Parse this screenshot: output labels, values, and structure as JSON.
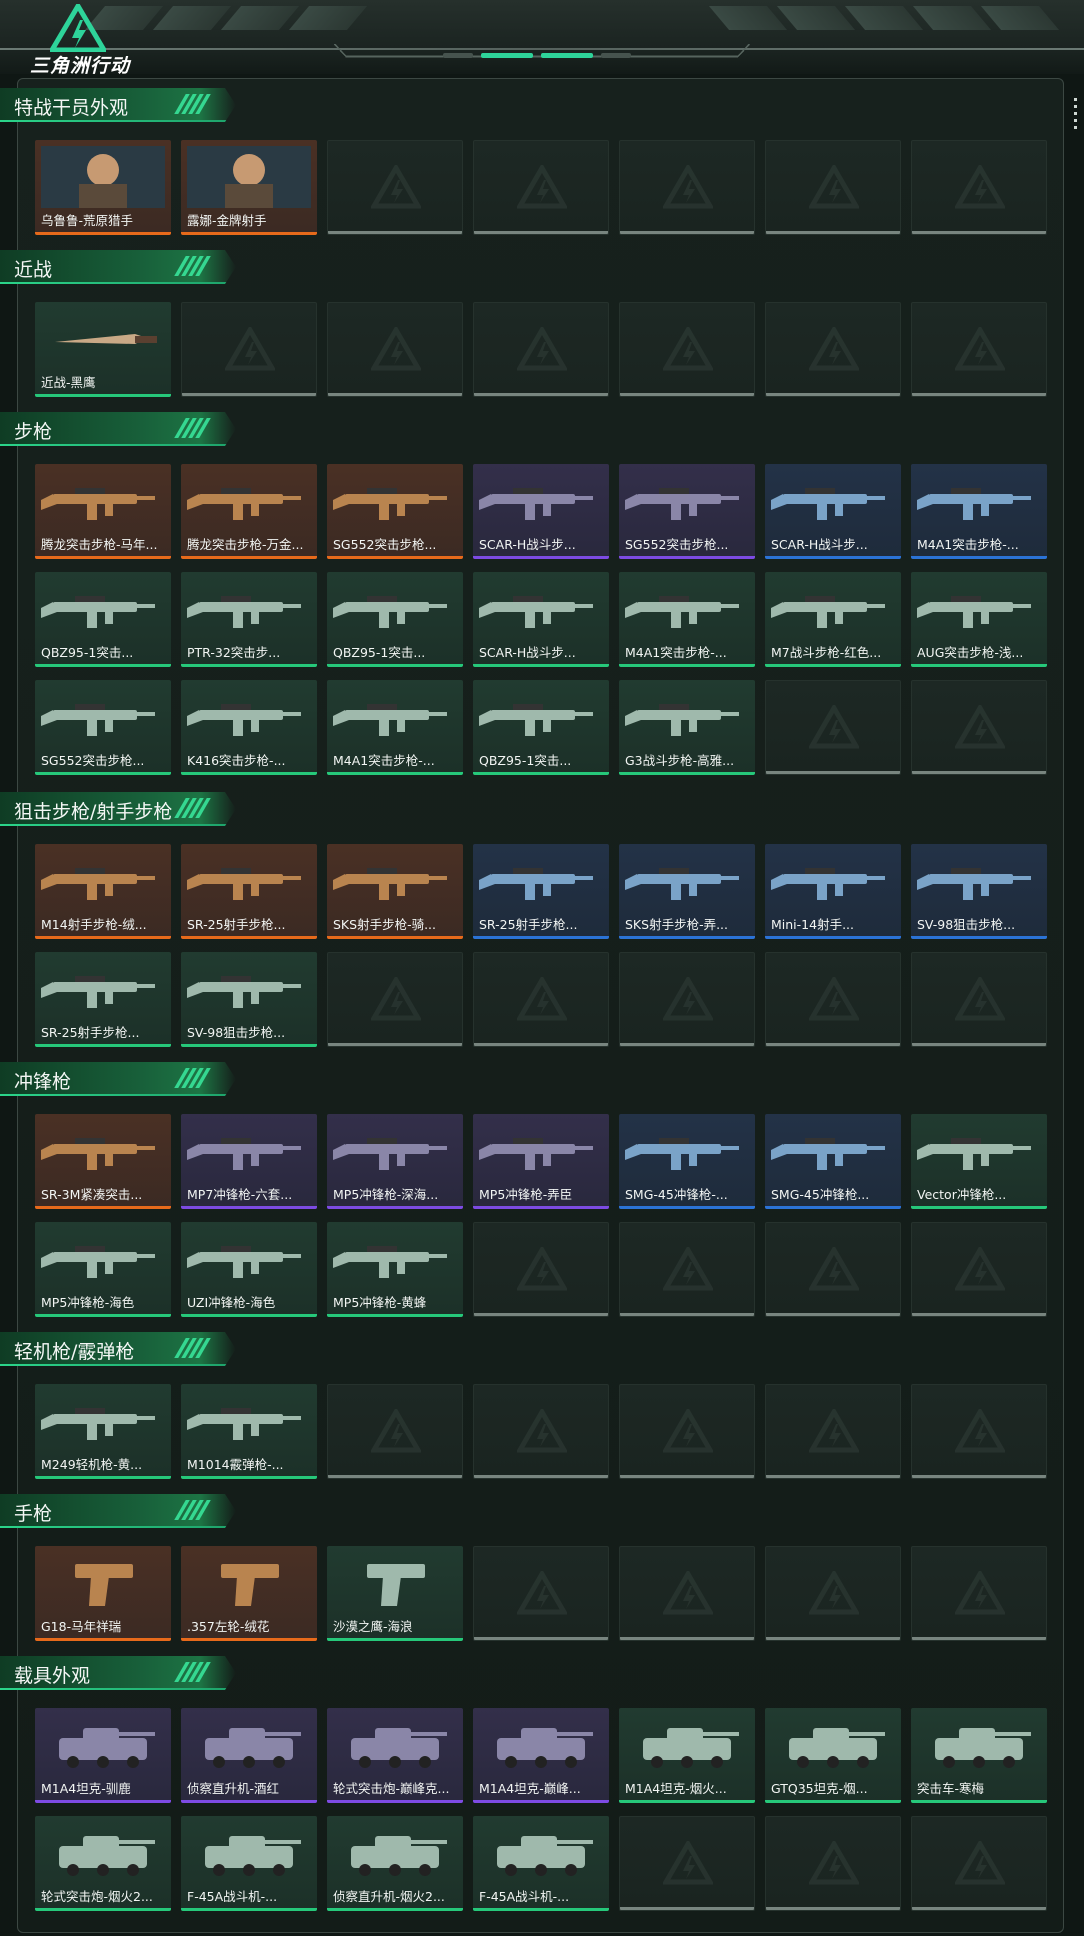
{
  "app": {
    "logo_text": "三角洲行动"
  },
  "colors": {
    "accent": "#2ed49a",
    "orange": "#e76a1b",
    "purple": "#7d4be3",
    "blue": "#2b73d6",
    "green": "#26c87a",
    "background": "#0f1714"
  },
  "sections": [
    {
      "title": "特战干员外观",
      "items": [
        {
          "label": "乌鲁鲁-荒原猎手",
          "rarity": "orange"
        },
        {
          "label": "露娜-金牌射手",
          "rarity": "orange"
        }
      ]
    },
    {
      "title": "近战",
      "items": [
        {
          "label": "近战-黑鹰",
          "rarity": "green"
        }
      ]
    },
    {
      "title": "步枪",
      "items": [
        {
          "label": "腾龙突击步枪-马年...",
          "rarity": "orange"
        },
        {
          "label": "腾龙突击步枪-万金...",
          "rarity": "orange"
        },
        {
          "label": "SG552突击步枪...",
          "rarity": "orange"
        },
        {
          "label": "SCAR-H战斗步...",
          "rarity": "purple"
        },
        {
          "label": "SG552突击步枪...",
          "rarity": "purple"
        },
        {
          "label": "SCAR-H战斗步...",
          "rarity": "blue"
        },
        {
          "label": "M4A1突击步枪-...",
          "rarity": "blue"
        },
        {
          "label": "QBZ95-1突击...",
          "rarity": "green"
        },
        {
          "label": "PTR-32突击步...",
          "rarity": "green"
        },
        {
          "label": "QBZ95-1突击...",
          "rarity": "green"
        },
        {
          "label": "SCAR-H战斗步...",
          "rarity": "green"
        },
        {
          "label": "M4A1突击步枪-...",
          "rarity": "green"
        },
        {
          "label": "M7战斗步枪-红色...",
          "rarity": "green"
        },
        {
          "label": "AUG突击步枪-浅...",
          "rarity": "green"
        },
        {
          "label": "SG552突击步枪...",
          "rarity": "green"
        },
        {
          "label": "K416突击步枪-...",
          "rarity": "green"
        },
        {
          "label": "M4A1突击步枪-...",
          "rarity": "green"
        },
        {
          "label": "QBZ95-1突击...",
          "rarity": "green"
        },
        {
          "label": "G3战斗步枪-高雅...",
          "rarity": "green"
        }
      ]
    },
    {
      "title": "狙击步枪/射手步枪",
      "items": [
        {
          "label": "M14射手步枪-绒...",
          "rarity": "orange"
        },
        {
          "label": "SR-25射手步枪...",
          "rarity": "orange"
        },
        {
          "label": "SKS射手步枪-骑...",
          "rarity": "orange"
        },
        {
          "label": "SR-25射手步枪...",
          "rarity": "blue"
        },
        {
          "label": "SKS射手步枪-弄...",
          "rarity": "blue"
        },
        {
          "label": "Mini-14射手...",
          "rarity": "blue"
        },
        {
          "label": "SV-98狙击步枪...",
          "rarity": "blue"
        },
        {
          "label": "SR-25射手步枪...",
          "rarity": "green"
        },
        {
          "label": "SV-98狙击步枪...",
          "rarity": "green"
        }
      ]
    },
    {
      "title": "冲锋枪",
      "items": [
        {
          "label": "SR-3M紧凑突击...",
          "rarity": "orange"
        },
        {
          "label": "MP7冲锋枪-六套...",
          "rarity": "purple"
        },
        {
          "label": "MP5冲锋枪-深海...",
          "rarity": "purple"
        },
        {
          "label": "MP5冲锋枪-弄臣",
          "rarity": "purple"
        },
        {
          "label": "SMG-45冲锋枪-...",
          "rarity": "blue"
        },
        {
          "label": "SMG-45冲锋枪...",
          "rarity": "blue"
        },
        {
          "label": "Vector冲锋枪...",
          "rarity": "green"
        },
        {
          "label": "MP5冲锋枪-海色",
          "rarity": "green"
        },
        {
          "label": "UZI冲锋枪-海色",
          "rarity": "green"
        },
        {
          "label": "MP5冲锋枪-黄蜂",
          "rarity": "green"
        }
      ]
    },
    {
      "title": "轻机枪/霰弹枪",
      "items": [
        {
          "label": "M249轻机枪-黄...",
          "rarity": "green"
        },
        {
          "label": "M1014霰弹枪-...",
          "rarity": "green"
        }
      ]
    },
    {
      "title": "手枪",
      "items": [
        {
          "label": "G18-马年祥瑞",
          "rarity": "orange"
        },
        {
          "label": ".357左轮-绒花",
          "rarity": "orange"
        },
        {
          "label": "沙漠之鹰-海浪",
          "rarity": "green"
        }
      ]
    },
    {
      "title": "载具外观",
      "items": [
        {
          "label": "M1A4坦克-驯鹿",
          "rarity": "purple"
        },
        {
          "label": "侦察直升机-酒红",
          "rarity": "purple"
        },
        {
          "label": "轮式突击炮-巅峰克...",
          "rarity": "purple"
        },
        {
          "label": "M1A4坦克-巅峰...",
          "rarity": "purple"
        },
        {
          "label": "M1A4坦克-烟火...",
          "rarity": "green"
        },
        {
          "label": "GTQ35坦克-烟...",
          "rarity": "green"
        },
        {
          "label": "突击车-寒梅",
          "rarity": "green"
        },
        {
          "label": "轮式突击炮-烟火2...",
          "rarity": "green"
        },
        {
          "label": "F-45A战斗机-...",
          "rarity": "green"
        },
        {
          "label": "侦察直升机-烟火2...",
          "rarity": "green"
        },
        {
          "label": "F-45A战斗机-...",
          "rarity": "green"
        }
      ]
    }
  ]
}
